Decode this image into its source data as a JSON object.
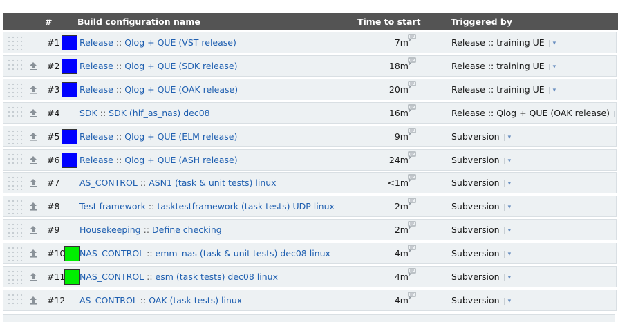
{
  "header": {
    "col_number": "#",
    "col_name": "Build configuration name",
    "col_time": "Time to start",
    "col_trigger": "Triggered by"
  },
  "colors": {
    "blue": "#0000ff",
    "green": "#00ee00",
    "link": "#1f5fb0",
    "header_bg": "#545454"
  },
  "rows": [
    {
      "num": "#1",
      "swatch": "blue",
      "project": "Release",
      "config": "Qlog + QUE (VST release)",
      "time": "7m",
      "trigger": "Release :: training UE",
      "up": false
    },
    {
      "num": "#2",
      "swatch": "blue",
      "project": "Release",
      "config": "Qlog + QUE (SDK release)",
      "time": "18m",
      "trigger": "Release :: training UE",
      "up": true
    },
    {
      "num": "#3",
      "swatch": "blue",
      "project": "Release",
      "config": "Qlog + QUE (OAK release)",
      "time": "20m",
      "trigger": "Release :: training UE",
      "up": true
    },
    {
      "num": "#4",
      "swatch": "",
      "project": "SDK",
      "config": "SDK (hif_as_nas) dec08",
      "time": "16m",
      "trigger": "Release :: Qlog + QUE (OAK release)",
      "up": true
    },
    {
      "num": "#5",
      "swatch": "blue",
      "project": "Release",
      "config": "Qlog + QUE (ELM release)",
      "time": "9m",
      "trigger": "Subversion",
      "up": true
    },
    {
      "num": "#6",
      "swatch": "blue",
      "project": "Release",
      "config": "Qlog + QUE (ASH release)",
      "time": "24m",
      "trigger": "Subversion",
      "up": true
    },
    {
      "num": "#7",
      "swatch": "",
      "project": "AS_CONTROL",
      "config": "ASN1 (task & unit tests) linux",
      "time": "<1m",
      "trigger": "Subversion",
      "up": true
    },
    {
      "num": "#8",
      "swatch": "",
      "project": "Test framework",
      "config": "tasktestframework (task tests) UDP linux",
      "time": "2m",
      "trigger": "Subversion",
      "up": true
    },
    {
      "num": "#9",
      "swatch": "",
      "project": "Housekeeping",
      "config": "Define checking",
      "time": "2m",
      "trigger": "Subversion",
      "up": true
    },
    {
      "num": "#10",
      "swatch": "green",
      "project": "NAS_CONTROL",
      "config": "emm_nas (task & unit tests) dec08 linux",
      "time": "4m",
      "trigger": "Subversion",
      "up": true
    },
    {
      "num": "#11",
      "swatch": "green",
      "project": "NAS_CONTROL",
      "config": "esm (task tests) dec08 linux",
      "time": "4m",
      "trigger": "Subversion",
      "up": true
    },
    {
      "num": "#12",
      "swatch": "",
      "project": "AS_CONTROL",
      "config": "OAK (task tests) linux",
      "time": "4m",
      "trigger": "Subversion",
      "up": true
    }
  ],
  "separator": "::",
  "icons": {
    "drag": "drag-handle-icon",
    "move_up": "move-to-top-icon",
    "comment": "comment-bubble-icon",
    "dropdown": "chevron-down-icon"
  }
}
